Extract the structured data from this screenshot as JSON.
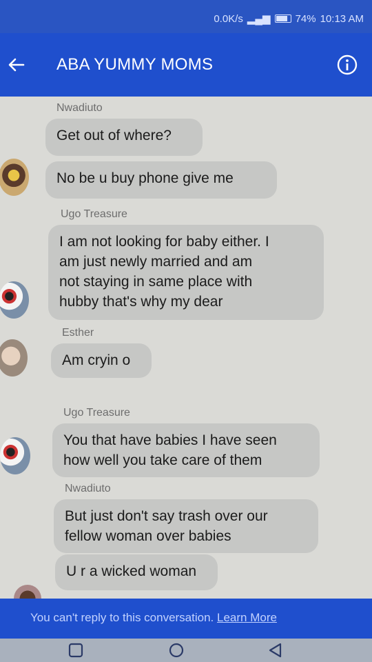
{
  "status": {
    "speed": "0.0K/s",
    "battery": "74%",
    "time": "10:13 AM"
  },
  "header": {
    "title": "ABA YUMMY MOMS"
  },
  "messages": [
    {
      "sender": "Nwadiuto"
    },
    {
      "text": "Get out of where?"
    },
    {
      "text": "No be u buy phone give me"
    },
    {
      "sender": "Ugo Treasure"
    },
    {
      "lines": [
        "I am not looking for baby either. I",
        "am just newly married and am",
        "not staying in same place with",
        "hubby  that's why my dear"
      ]
    },
    {
      "sender": "Esther"
    },
    {
      "text": "Am cryin o"
    },
    {
      "sender": "Ugo Treasure"
    },
    {
      "lines": [
        "You that have babies I have seen",
        "how well you take care of them"
      ]
    },
    {
      "sender": "Nwadiuto"
    },
    {
      "lines": [
        "But just don't say trash over our",
        "fellow woman over babies"
      ]
    },
    {
      "text": "U r a wicked woman"
    }
  ],
  "footer": {
    "text": "You can't reply to this conversation.",
    "link": "Learn More"
  },
  "colors": {
    "header": "#1f4fcd",
    "status_bar": "#2a55c2",
    "bubble": "#c6c7c5",
    "background": "#dadad6"
  },
  "icons": {
    "back": "back-arrow-icon",
    "info": "info-icon",
    "recents": "recents-square-icon",
    "home": "home-circle-icon",
    "back_nav": "back-triangle-icon"
  }
}
